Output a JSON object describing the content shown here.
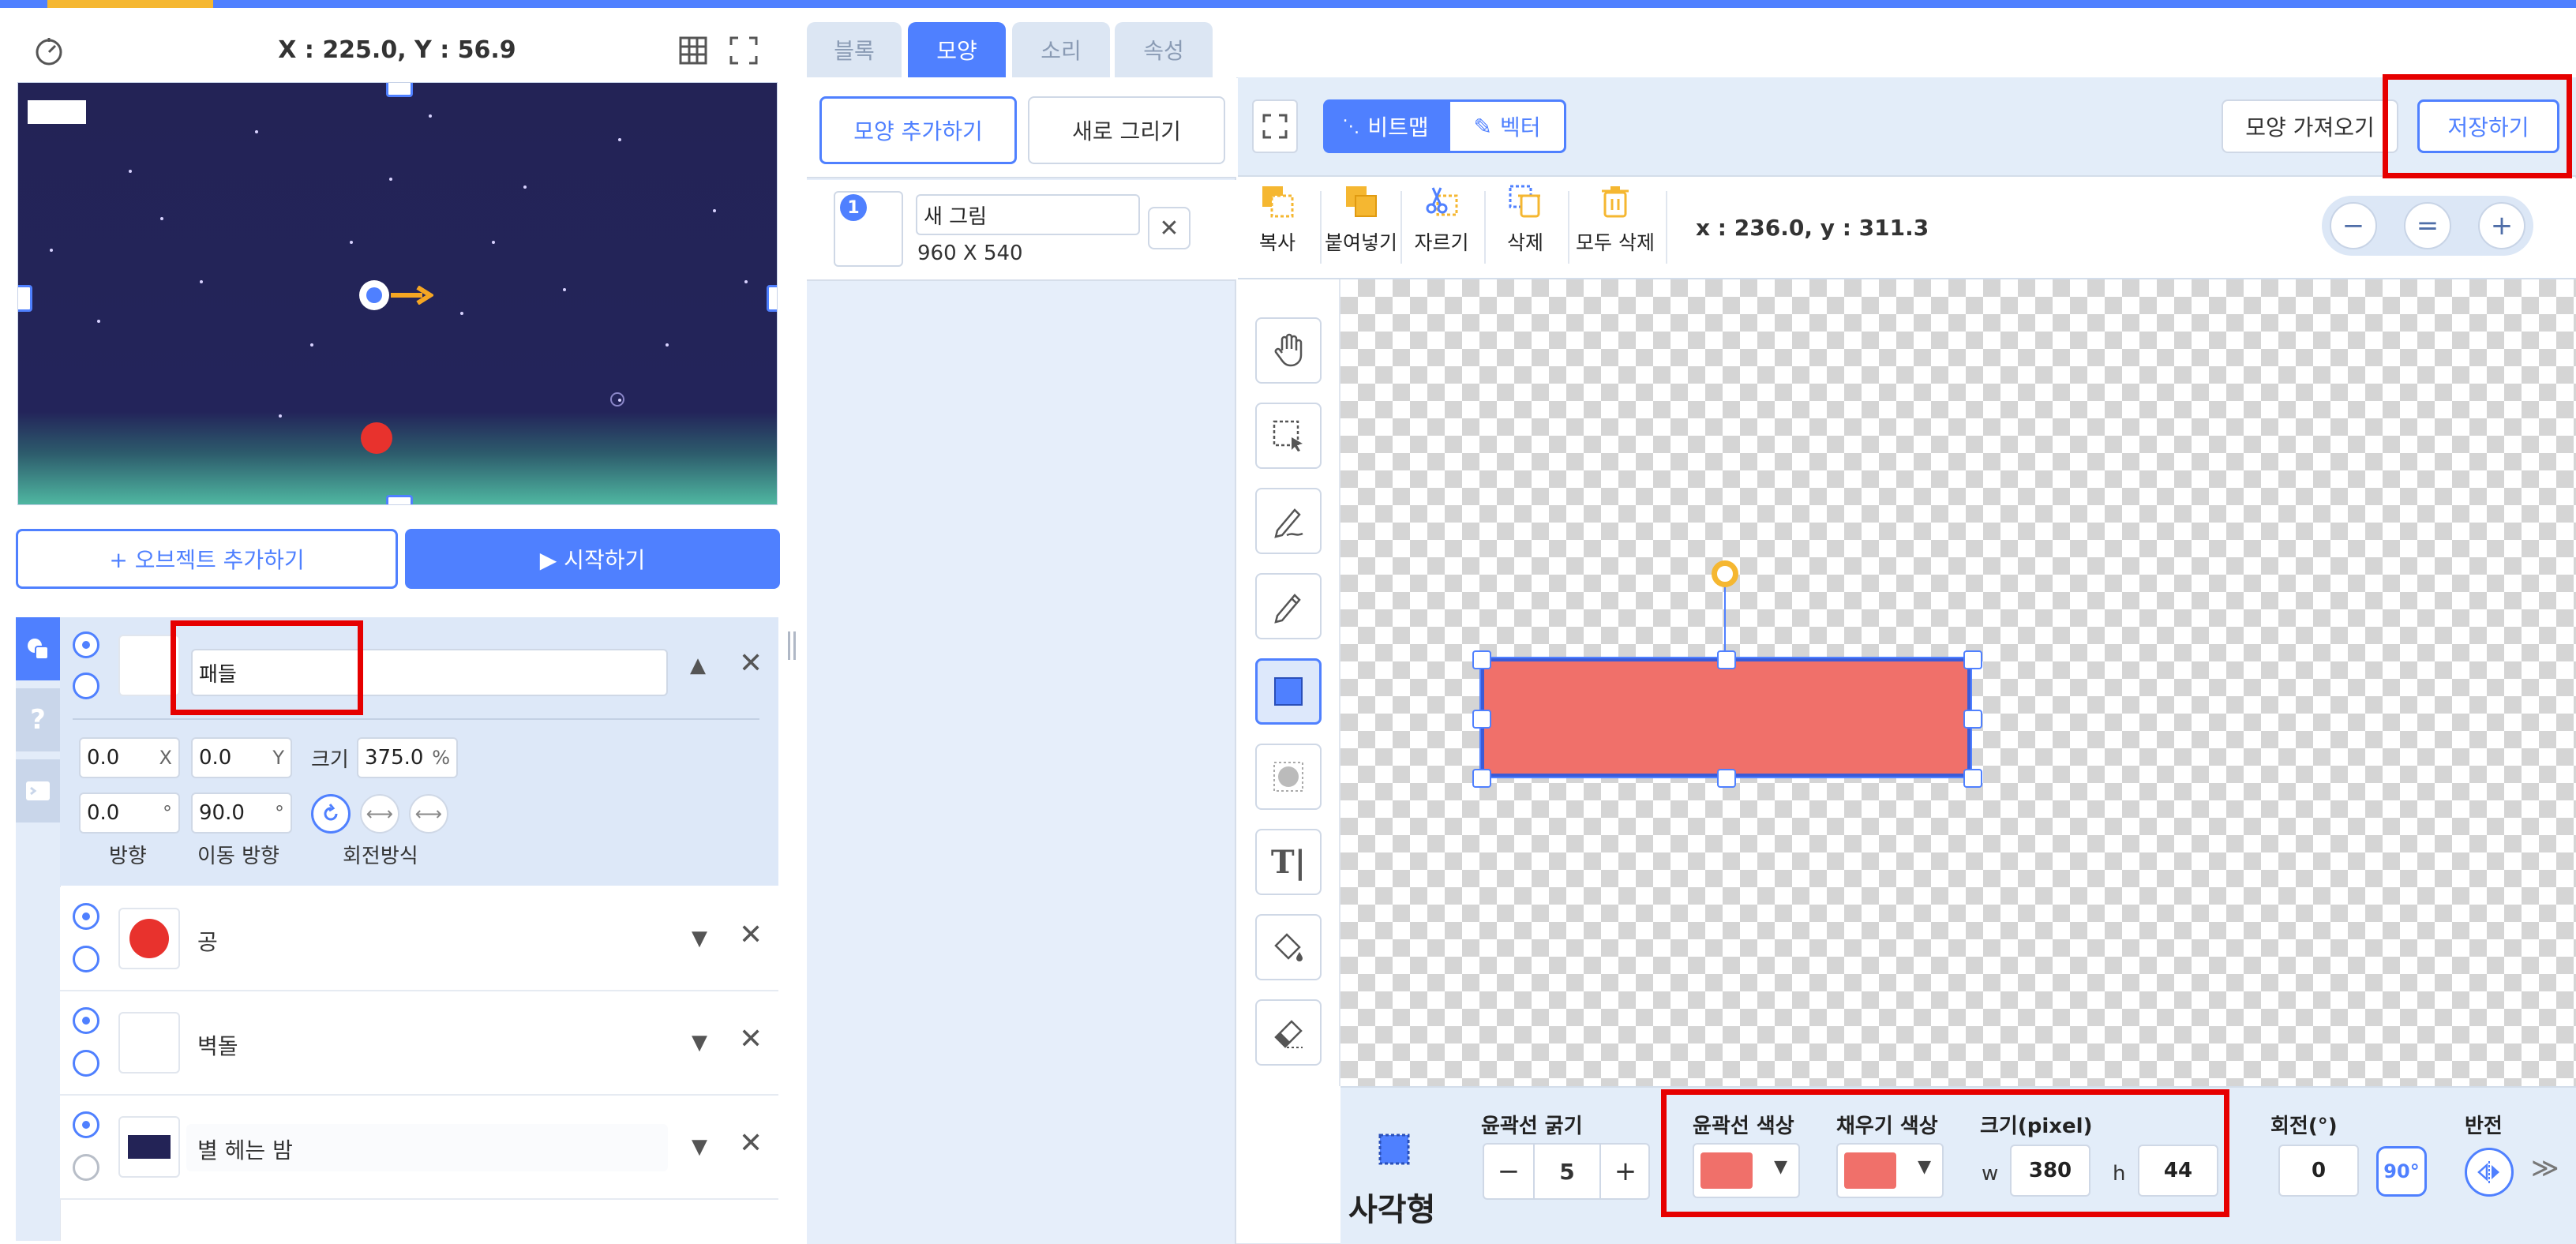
{
  "colors": {
    "accent": "#4f80ff",
    "highlight": "#e60000",
    "rect_fill": "#f0706a",
    "ball": "#e8322d"
  },
  "stage": {
    "coordinates": "X : 225.0, Y : 56.9",
    "speed_icon": "gauge-icon",
    "grid_icon": "grid-icon",
    "fullscreen_icon": "fullscreen-icon"
  },
  "actions": {
    "add_object": "+ 오브젝트 추가하기",
    "start": "▶ 시작하기"
  },
  "selected_object": {
    "name": "패들",
    "x": "0.0",
    "x_unit": "X",
    "y": "0.0",
    "y_unit": "Y",
    "size_label": "크기",
    "size": "375.0",
    "size_unit": "%",
    "direction": "0.0",
    "direction_unit": "°",
    "move_direction": "90.0",
    "move_direction_unit": "°",
    "labels": {
      "direction": "방향",
      "move_direction": "이동 방향",
      "rotation": "회전방식"
    }
  },
  "objects": [
    {
      "name": "공"
    },
    {
      "name": "벽돌"
    },
    {
      "name": "별 헤는 밤"
    }
  ],
  "tabs": [
    {
      "label": "블록"
    },
    {
      "label": "모양"
    },
    {
      "label": "소리"
    },
    {
      "label": "속성"
    }
  ],
  "costume": {
    "add_label": "모양 추가하기",
    "new_draw_label": "새로 그리기",
    "item": {
      "index": "1",
      "name": "새 그림",
      "size": "960 X 540"
    }
  },
  "paint": {
    "mode_bitmap": "비트맵",
    "mode_vector": "벡터",
    "import_label": "모양 가져오기",
    "save_label": "저장하기",
    "edit_buttons": [
      {
        "label": "복사"
      },
      {
        "label": "붙여넣기"
      },
      {
        "label": "자르기"
      },
      {
        "label": "삭제"
      },
      {
        "label": "모두 삭제"
      }
    ],
    "cursor_coords": "x : 236.0, y : 311.3",
    "zoom": {
      "minus": "−",
      "reset": "=",
      "plus": "+"
    }
  },
  "props": {
    "shape_name": "사각형",
    "stroke_width_label": "윤곽선 굵기",
    "stroke_width": "5",
    "stroke_color_label": "윤곽선 색상",
    "fill_color_label": "채우기 색상",
    "size_label": "크기(pixel)",
    "w_label": "w",
    "w": "380",
    "h_label": "h",
    "h": "44",
    "rotation_label": "회전(°)",
    "rotation": "0",
    "rotate90": "90°",
    "flip_label": "반전",
    "more": "≫",
    "minus": "−",
    "plus": "+"
  }
}
